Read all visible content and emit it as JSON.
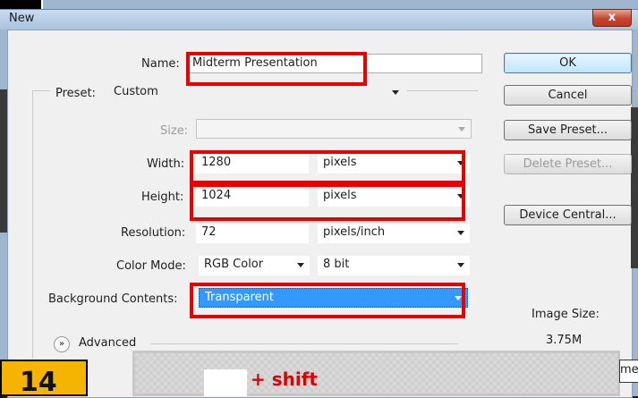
{
  "window": {
    "title": "New",
    "close_glyph": "x"
  },
  "form": {
    "name_label": "Name:",
    "name_value": "Midterm Presentation",
    "preset_label": "Preset:",
    "preset_value": "Custom",
    "size_label": "Size:",
    "size_value": "",
    "width_label": "Width:",
    "width_value": "1280",
    "width_unit": "pixels",
    "height_label": "Height:",
    "height_value": "1024",
    "height_unit": "pixels",
    "resolution_label": "Resolution:",
    "resolution_value": "72",
    "resolution_unit": "pixels/inch",
    "color_mode_label": "Color Mode:",
    "color_mode_value": "RGB Color",
    "bit_depth_value": "8 bit",
    "bg_label": "Background Contents:",
    "bg_value": "Transparent",
    "advanced_label": "Advanced",
    "advanced_icon": "double-chevron-down-icon"
  },
  "buttons": {
    "ok": "OK",
    "cancel": "Cancel",
    "save_preset": "Save Preset...",
    "delete_preset": "Delete Preset...",
    "device_central": "Device Central..."
  },
  "image_size": {
    "label": "Image Size:",
    "value": "3.75M"
  },
  "overlay": {
    "step_number": "14",
    "instruction": "+ shift",
    "partial_tag": "me"
  },
  "colors": {
    "highlight": "#e60000",
    "selection": "#3399ff",
    "badge": "#f4b400"
  }
}
